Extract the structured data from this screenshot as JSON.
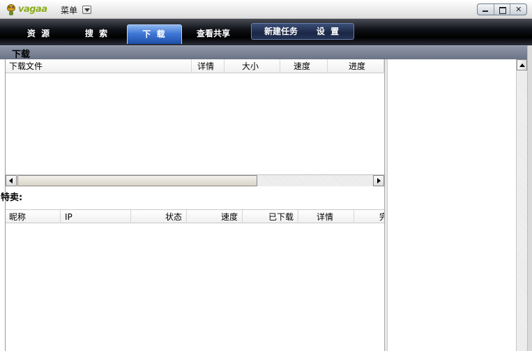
{
  "app": {
    "logo_text": "vagaa",
    "menu_label": "菜单"
  },
  "window_controls": {
    "close_glyph": "✕"
  },
  "toolbar": {
    "tabs": [
      {
        "label": "资 源",
        "active": false
      },
      {
        "label": "搜 索",
        "active": false
      },
      {
        "label": "下 载",
        "active": true
      },
      {
        "label": "查看共享",
        "active": false
      }
    ],
    "actions": [
      {
        "label": "新建任务"
      },
      {
        "label": "设 置"
      }
    ]
  },
  "section": {
    "title": "下载"
  },
  "download_list": {
    "columns": [
      "下载文件",
      "详情",
      "大小",
      "速度",
      "进度"
    ],
    "rows": []
  },
  "special_sale": {
    "label": "特卖:"
  },
  "peer_list": {
    "columns": [
      "昵称",
      "IP",
      "状态",
      "速度",
      "已下载",
      "详情",
      "完"
    ],
    "rows": []
  },
  "icons": {
    "menu_dropdown": "chevron-down-icon",
    "minimize": "minimize-icon",
    "maximize": "maximize-icon",
    "close": "close-icon"
  },
  "colors": {
    "active_tab": "#3f78d6",
    "toolbar_bg": "#101218",
    "section_bar": "#6b7486",
    "logo": "#8cae1c"
  }
}
